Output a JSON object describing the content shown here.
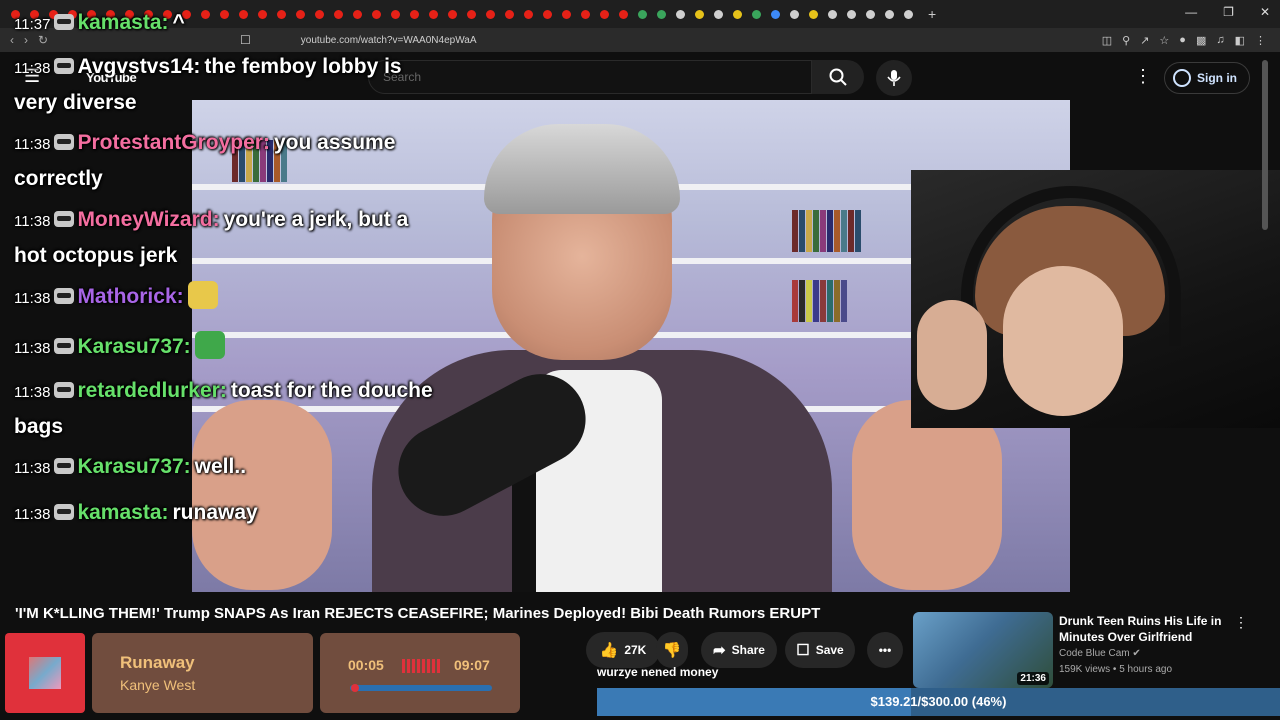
{
  "browser": {
    "url": "youtube.com/watch?v=WAA0N4epWaA",
    "new_tab_label": "+"
  },
  "youtube": {
    "logo": "YouTube",
    "search_placeholder": "Search",
    "sign_in": "Sign in"
  },
  "video": {
    "title": "'I'M K*LLING THEM!' Trump SNAPS As Iran REJECTS CEASEFIRE; Marines Deployed! Bibi Death Rumors ERUPT",
    "likes": "27K",
    "share": "Share",
    "save": "Save",
    "more": "•••"
  },
  "chat": [
    {
      "time": "11:37",
      "user": "kamasta:",
      "user_color": "#66e06a",
      "text": "^"
    },
    {
      "time": "11:38",
      "user": "Avgvstvs14:",
      "user_color": "#ffffff",
      "text": "the femboy lobby is very diverse"
    },
    {
      "time": "11:38",
      "user": "ProtestantGroyper:",
      "user_color": "#f46ea0",
      "text": "you assume correctly"
    },
    {
      "time": "11:38",
      "user": "MoneyWizard:",
      "user_color": "#f46ea0",
      "text": "you're a jerk, but a hot octopus jerk"
    },
    {
      "time": "11:38",
      "user": "Mathorick:",
      "user_color": "#a865e6",
      "text": ""
    },
    {
      "time": "11:38",
      "user": "Karasu737:",
      "user_color": "#66e06a",
      "text": ""
    },
    {
      "time": "11:38",
      "user": "retardedlurker:",
      "user_color": "#66e06a",
      "text": "toast for the douche bags"
    },
    {
      "time": "11:38",
      "user": "Karasu737:",
      "user_color": "#66e06a",
      "text": "well.."
    },
    {
      "time": "11:38",
      "user": "kamasta:",
      "user_color": "#66e06a",
      "text": "runaway"
    }
  ],
  "music": {
    "song": "Runaway",
    "artist": "Kanye West",
    "elapsed": "00:05",
    "total": "09:07",
    "progress": 0.01
  },
  "subline": "wurzye nened money",
  "goal": {
    "text": "$139.21/$300.00 (46%)",
    "progress": 0.46
  },
  "recommendation": {
    "title": "Drunk Teen Ruins His Life in Minutes Over Girlfriend",
    "channel": "Code Blue Cam",
    "views": "159K views",
    "age": "5 hours ago",
    "duration": "21:36"
  }
}
